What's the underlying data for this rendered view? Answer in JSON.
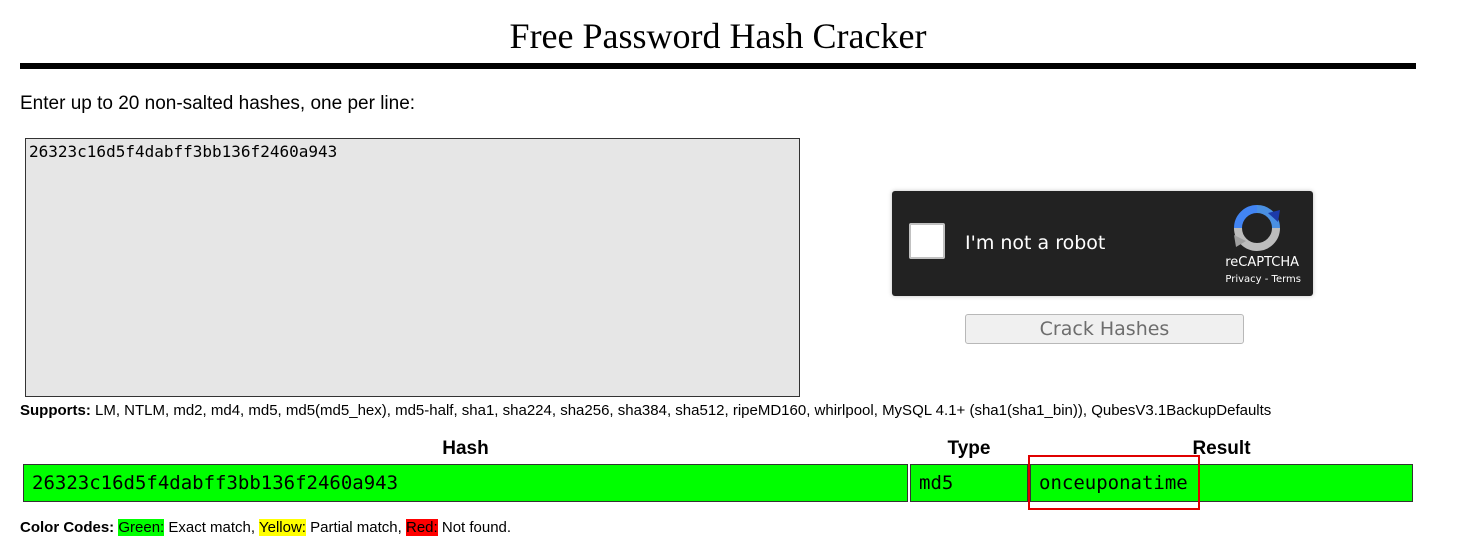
{
  "page_title": "Free Password Hash Cracker",
  "instructions": "Enter up to 20 non-salted hashes, one per line:",
  "hash_input": {
    "value": "26323c16d5f4dabff3bb136f2460a943",
    "placeholder": ""
  },
  "captcha": {
    "label": "I'm not a robot",
    "brand": "reCAPTCHA",
    "privacy": "Privacy",
    "separator": " - ",
    "terms": "Terms",
    "icon": "recaptcha-logo-icon",
    "checked": false
  },
  "crack_button_label": "Crack Hashes",
  "supports": {
    "label": "Supports:",
    "text": " LM, NTLM, md2, md4, md5, md5(md5_hex), md5-half, sha1, sha224, sha256, sha384, sha512, ripeMD160, whirlpool, MySQL 4.1+ (sha1(sha1_bin)), QubesV3.1BackupDefaults"
  },
  "results": {
    "headers": {
      "hash": "Hash",
      "type": "Type",
      "result": "Result"
    },
    "rows": [
      {
        "hash": "26323c16d5f4dabff3bb136f2460a943",
        "type": "md5",
        "result": "onceuponatime",
        "status": "exact",
        "color": "#00ff00"
      }
    ]
  },
  "color_codes": {
    "label": "Color Codes:",
    "green_label": "Green:",
    "green_text": " Exact match, ",
    "yellow_label": "Yellow:",
    "yellow_text": " Partial match, ",
    "red_label": "Red:",
    "red_text": " Not found.",
    "colors": {
      "green": "#00ff00",
      "yellow": "#ffff00",
      "red": "#ff0000"
    }
  },
  "annotation": {
    "highlight_color": "#e00000"
  }
}
